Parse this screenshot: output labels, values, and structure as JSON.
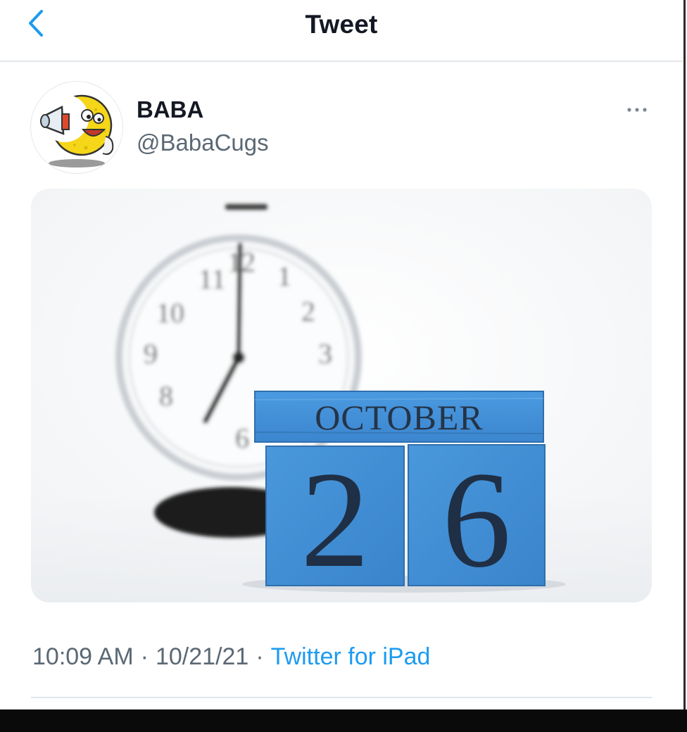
{
  "header": {
    "title": "Tweet",
    "back_icon": "chevron-left-icon"
  },
  "tweet": {
    "author": {
      "name": "BABA",
      "handle": "@BabaCugs",
      "avatar_icon": "moon-megaphone-mascot"
    },
    "more_icon": "more-horizontal-icon",
    "media": {
      "block_month": "OCTOBER",
      "block_day_1": "2",
      "block_day_2": "6"
    },
    "time": "10:09 AM",
    "separator": "·",
    "date": "10/21/21",
    "source": "Twitter for iPad"
  },
  "colors": {
    "accent": "#1d9bf0",
    "text_primary": "#141823",
    "text_secondary": "#5b6874",
    "block_blue": "#3f8fd8"
  }
}
